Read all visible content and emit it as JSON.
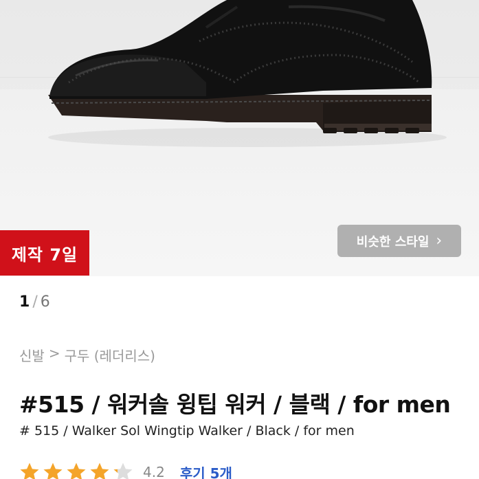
{
  "product_image": {
    "badge": "제작 7일",
    "similar_style_button": "비슷한 스타일",
    "similar_style_icon": "chevron-right-icon"
  },
  "pager": {
    "current": "1",
    "separator": "/",
    "total": "6"
  },
  "breadcrumb": {
    "category": "신발",
    "arrow": ">",
    "subcategory": "구두 (레더리스)"
  },
  "product": {
    "title": "#515 / 워커솔 윙팁 워커 / 블랙 / for men",
    "subtitle": "# 515 / Walker Sol Wingtip Walker / Black / for men",
    "rating": 4.2,
    "rating_text": "4.2",
    "review_label": "후기 5개"
  },
  "colors": {
    "badge": "#d0111a",
    "star": "#f4a42a",
    "link": "#2b5cc8"
  }
}
